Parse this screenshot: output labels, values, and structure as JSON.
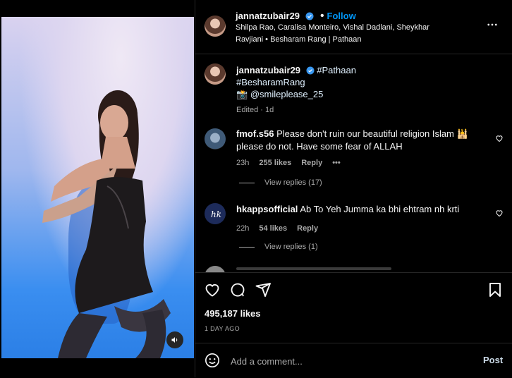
{
  "post": {
    "username": "jannatzubair29",
    "follow_label": "Follow",
    "audio_line": "Shilpa Rao, Caralisa Monteiro, Vishal Dadlani, Sheykhar Ravjiani • Besharam Rang | Pathaan",
    "caption_tag1": "#Pathaan",
    "caption_tag2": "#BesharamRang",
    "caption_credit_icon": "📸",
    "caption_credit": "@smileplease_25",
    "caption_meta": "Edited · 1d",
    "likes": "495,187 likes",
    "time_ago": "1 DAY AGO"
  },
  "comments": [
    {
      "username": "fmof.s56",
      "text": "Please don't ruin our beautiful religion Islam 🕌 please do not. Have some fear of ALLAH",
      "time": "23h",
      "likes": "255 likes",
      "reply_label": "Reply",
      "more": "•••",
      "view_replies": "View replies (17)"
    },
    {
      "username": "hkappsofficial",
      "text": "Ab To Yeh Jumma ka bhi ehtram nh krti",
      "time": "22h",
      "likes": "54 likes",
      "reply_label": "Reply",
      "view_replies": "View replies (1)"
    }
  ],
  "comment_box": {
    "placeholder": "Add a comment...",
    "post_label": "Post"
  },
  "icons": {
    "like": "heart-icon",
    "comment": "comment-bubble-icon",
    "share": "paper-plane-icon",
    "save": "bookmark-icon",
    "emoji": "smiley-icon",
    "more": "more-horizontal-icon",
    "mute": "speaker-icon",
    "verified": "verified-badge-icon"
  },
  "colors": {
    "background": "#000000",
    "link_blue": "#0095f6",
    "verified_blue": "#3897f0",
    "secondary_text": "#a8a8a8"
  }
}
